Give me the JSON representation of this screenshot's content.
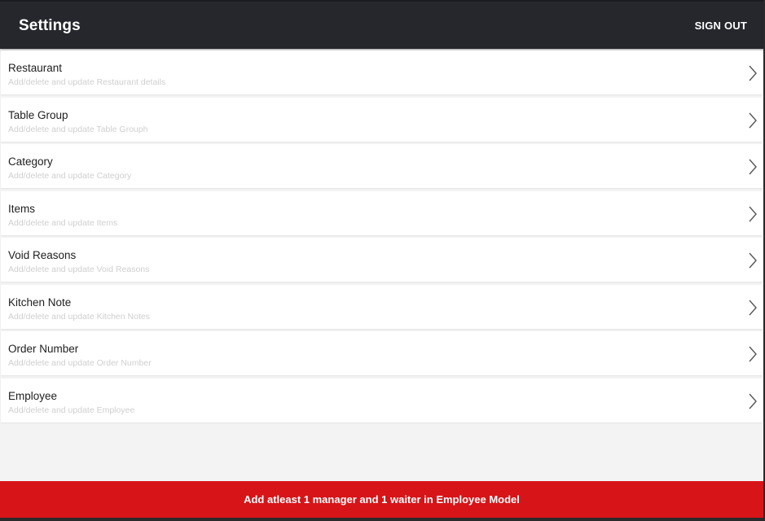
{
  "appbar": {
    "title": "Settings",
    "sign_out_label": "SIGN OUT"
  },
  "settings": {
    "items": [
      {
        "title": "Restaurant",
        "subtitle": "Add/delete and update Restaurant details"
      },
      {
        "title": "Table Group",
        "subtitle": "Add/delete and update Table Grouph"
      },
      {
        "title": "Category",
        "subtitle": "Add/delete and update Category"
      },
      {
        "title": "Items",
        "subtitle": "Add/delete and update Items"
      },
      {
        "title": "Void Reasons",
        "subtitle": "Add/delete and update Void Reasons"
      },
      {
        "title": "Kitchen Note",
        "subtitle": "Add/delete and update Kitchen Notes"
      },
      {
        "title": "Order Number",
        "subtitle": "Add/delete and update Order Number"
      },
      {
        "title": "Employee",
        "subtitle": "Add/delete and update Employee"
      }
    ]
  },
  "footer": {
    "message": "Add atleast 1 manager and 1 waiter in Employee Model"
  },
  "colors": {
    "appbar_bg": "#25272d",
    "footer_bg": "#d71418",
    "page_bg": "#f3f3f3",
    "item_bg": "#ffffff"
  },
  "icons": {
    "row_chevron": "chevron-right-icon"
  }
}
